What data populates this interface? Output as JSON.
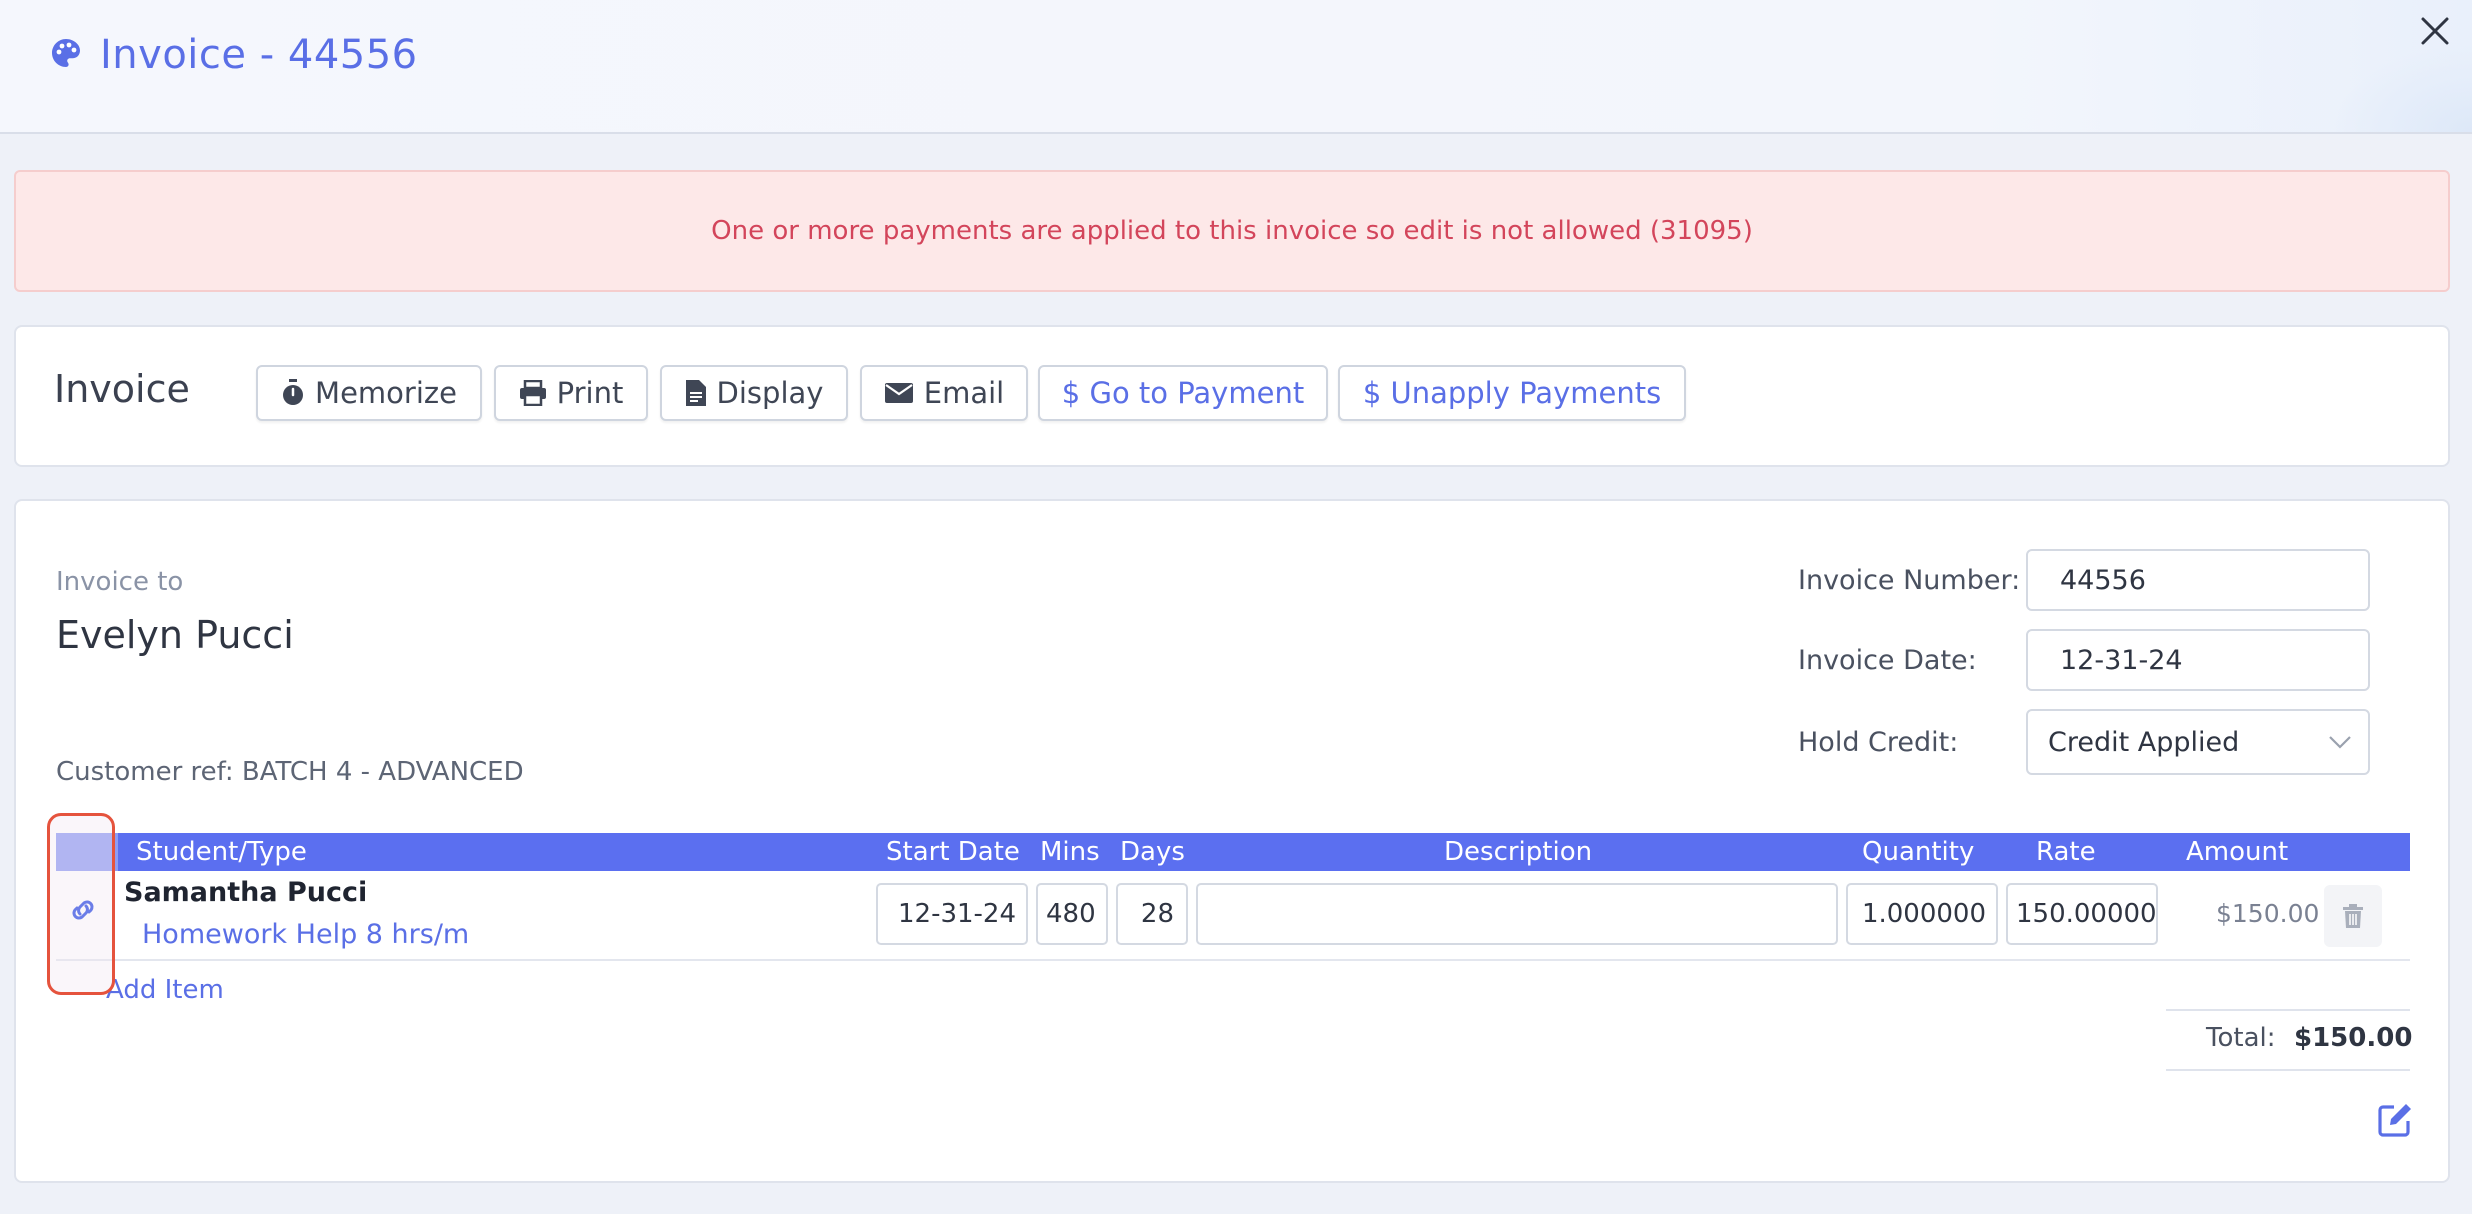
{
  "header": {
    "title": "Invoice - 44556",
    "title_icon": "palette-icon",
    "close_icon": "close-icon"
  },
  "alert": {
    "message": "One or more payments are applied to this invoice so edit is not allowed (31095)"
  },
  "toolbar": {
    "title": "Invoice",
    "buttons": {
      "memorize": "Memorize",
      "print": "Print",
      "display": "Display",
      "email": "Email",
      "go_to_payment": "$ Go to Payment",
      "unapply_payments": "$ Unapply Payments"
    }
  },
  "invoice": {
    "invoice_to_label": "Invoice to",
    "customer_name": "Evelyn Pucci",
    "customer_ref": "Customer ref: BATCH 4 - ADVANCED",
    "fields": {
      "number_label": "Invoice Number:",
      "number_value": "44556",
      "date_label": "Invoice Date:",
      "date_value": "12-31-24",
      "hold_credit_label": "Hold Credit:",
      "hold_credit_value": "Credit Applied"
    }
  },
  "table": {
    "headers": {
      "student_type": "Student/Type",
      "start_date": "Start Date",
      "mins": "Mins",
      "days": "Days",
      "description": "Description",
      "quantity": "Quantity",
      "rate": "Rate",
      "amount": "Amount"
    },
    "rows": [
      {
        "student": "Samantha Pucci",
        "type": "Homework Help 8 hrs/m",
        "start_date": "12-31-24",
        "mins": "480",
        "days": "28",
        "description": "",
        "quantity": "1.000000",
        "rate": "150.00000",
        "amount": "$150.00"
      }
    ],
    "add_item": "Add Item",
    "total_label": "Total:",
    "total_value": "$150.00"
  },
  "colors": {
    "accent": "#5a6fe6",
    "table_header": "#5b6ff0",
    "alert_bg": "#fde8e8",
    "alert_text": "#d3455b",
    "highlight": "#e5533d"
  }
}
